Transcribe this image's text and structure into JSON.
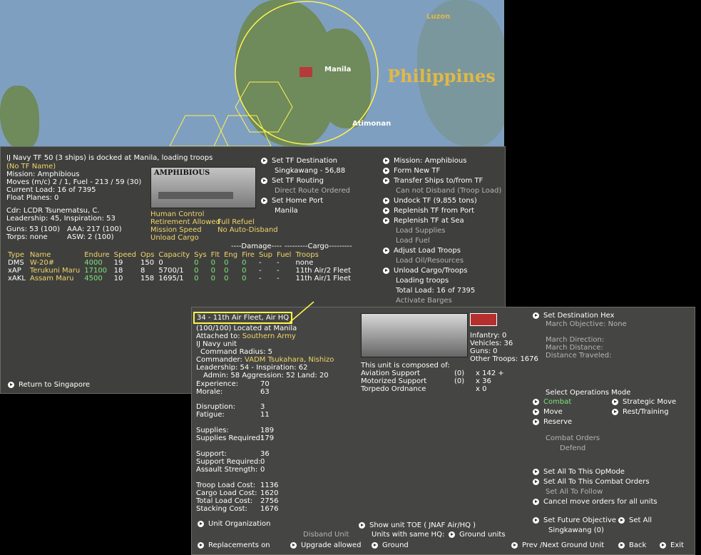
{
  "map": {
    "labels": [
      "Luzon",
      "Philippines",
      "Manila",
      "Atimonan"
    ]
  },
  "tf": {
    "header": "IJ Navy TF 50 (3 ships) is docked at Manila, loading troops",
    "name": "(No TF Name)",
    "mission": "Mission: Amphibious",
    "moves": "Moves (m/c) 2 / 1, Fuel - 213 / 59 (30)",
    "current_load": "Current Load: 16 of 7395",
    "float_planes": "Float Planes: 0",
    "cdr": "Cdr: LCDR Tsunematsu, C.",
    "leadership": "Leadership: 45, Inspiration: 53",
    "guns": "Guns: 53 (100)",
    "aaa": "AAA: 217 (100)",
    "torps": "Torps: none",
    "asw": "ASW: 2 (100)",
    "img_label": "AMPHIBIOUS",
    "controls": [
      "Human Control",
      "Retirement Allowed",
      "Mission Speed",
      "Unload Cargo"
    ],
    "controls2": [
      "Full Refuel",
      "No Auto-Disband"
    ],
    "table_headers": [
      "Type",
      "Name",
      "Endure",
      "Speed",
      "Ops",
      "Capacity",
      "Sys",
      "Flt",
      "Eng",
      "Fire",
      "Sup",
      "Fuel",
      "Troops"
    ],
    "rows": [
      [
        "DMS",
        "W-20#",
        "4000",
        "19",
        "150",
        "0",
        "0",
        "0",
        "0",
        "0",
        "-",
        "-",
        "none"
      ],
      [
        "xAP",
        "Terukuni Maru",
        "17100",
        "18",
        "8",
        "5700/1",
        "0",
        "0",
        "0",
        "0",
        "-",
        "-",
        "11th Air/2 Fleet"
      ],
      [
        "xAKL",
        "Assam Maru",
        "4500",
        "10",
        "158",
        "1695/1",
        "0",
        "0",
        "0",
        "0",
        "-",
        "-",
        "11th Air/1 Fleet"
      ]
    ],
    "damage_label": "----Damage----",
    "cargo_label": "---------Cargo---------",
    "mid_menu": [
      "Set TF Destination",
      "Singkawang - 56,88",
      "Set TF Routing",
      "Direct Route Ordered",
      "Set Home Port",
      "Manila"
    ],
    "right_menu": [
      "Mission: Amphibious",
      "Form New TF",
      "Transfer Ships to/from TF",
      "Can not Disband (Troop Load)",
      "Undock TF (9,855 tons)",
      "Replenish TF from Port",
      "Replenish TF at Sea",
      "Load Supplies",
      "Load Fuel",
      "Adjust Load Troops",
      "Load Oil/Resources",
      "Unload Cargo/Troops",
      "Loading troops",
      "Total Load: 16 of 7395",
      "Activate Barges"
    ],
    "return": "Return to Singapore"
  },
  "unit": {
    "title": "34 - 11th Air Fleet, Air HQ",
    "located": "(100/100) Located at  Manila",
    "attached": "Attached to:",
    "attached_val": "Southern Army",
    "navy": "IJ Navy unit",
    "radius": "Command Radius: 5",
    "commander": "Commander:",
    "commander_val": "VADM Tsukahara, Nishizo",
    "lead": "Leadership: 54 - Inspiration: 62",
    "admin": "Admin: 58  Aggression: 52  Land: 20",
    "stats": [
      [
        "Experience:",
        "70"
      ],
      [
        "Morale:",
        "63"
      ],
      [
        "Disruption:",
        "3"
      ],
      [
        "Fatigue:",
        "11"
      ],
      [
        "Supplies:",
        "189"
      ],
      [
        "Supplies Required:",
        "179"
      ],
      [
        "Support:",
        "36"
      ],
      [
        "Support Required:",
        "0"
      ],
      [
        "Assault Strength:",
        "0"
      ],
      [
        "Troop Load Cost:",
        "1136"
      ],
      [
        "Cargo Load Cost:",
        "1620"
      ],
      [
        "Total Load Cost:",
        "2756"
      ],
      [
        "Stacking Cost:",
        "1676"
      ]
    ],
    "composition": [
      "Infantry: 0",
      "Vehicles: 36",
      "Guns: 0",
      "Other Troops: 1676"
    ],
    "composed": "This unit is composed of:",
    "comp_rows": [
      [
        "Aviation Support",
        "(0)",
        "x 142 +"
      ],
      [
        "Motorized Support",
        "(0)",
        "x 36"
      ],
      [
        "Torpedo Ordnance",
        "",
        "x 0"
      ]
    ],
    "dest": [
      "Set Destination Hex",
      "March Objective: None",
      "March Direction:",
      "March Distance:",
      "Distance Traveled:"
    ],
    "ops_mode": "Select Operations Mode",
    "ops": [
      "Combat",
      "Move",
      "Reserve",
      "Strategic Move",
      "Rest/Training"
    ],
    "combat_orders": "Combat Orders",
    "defend": "Defend",
    "set_all": [
      "Set All To This OpMode",
      "Set All To This Combat Orders",
      "Set All To Follow",
      "Cancel move orders for all units"
    ],
    "future": "Set Future Objective",
    "future_val": "Singkawang (0)",
    "set_all2": "Set All",
    "bottom": [
      "Unit Organization",
      "Replacements on",
      "Disband Unit",
      "Upgrade allowed",
      "Show unit TOE ( JNAF Air/HQ )",
      "Units with same HQ:",
      "Ground units",
      "Ground",
      "Prev /Next Ground Unit",
      "Back",
      "Exit"
    ]
  }
}
